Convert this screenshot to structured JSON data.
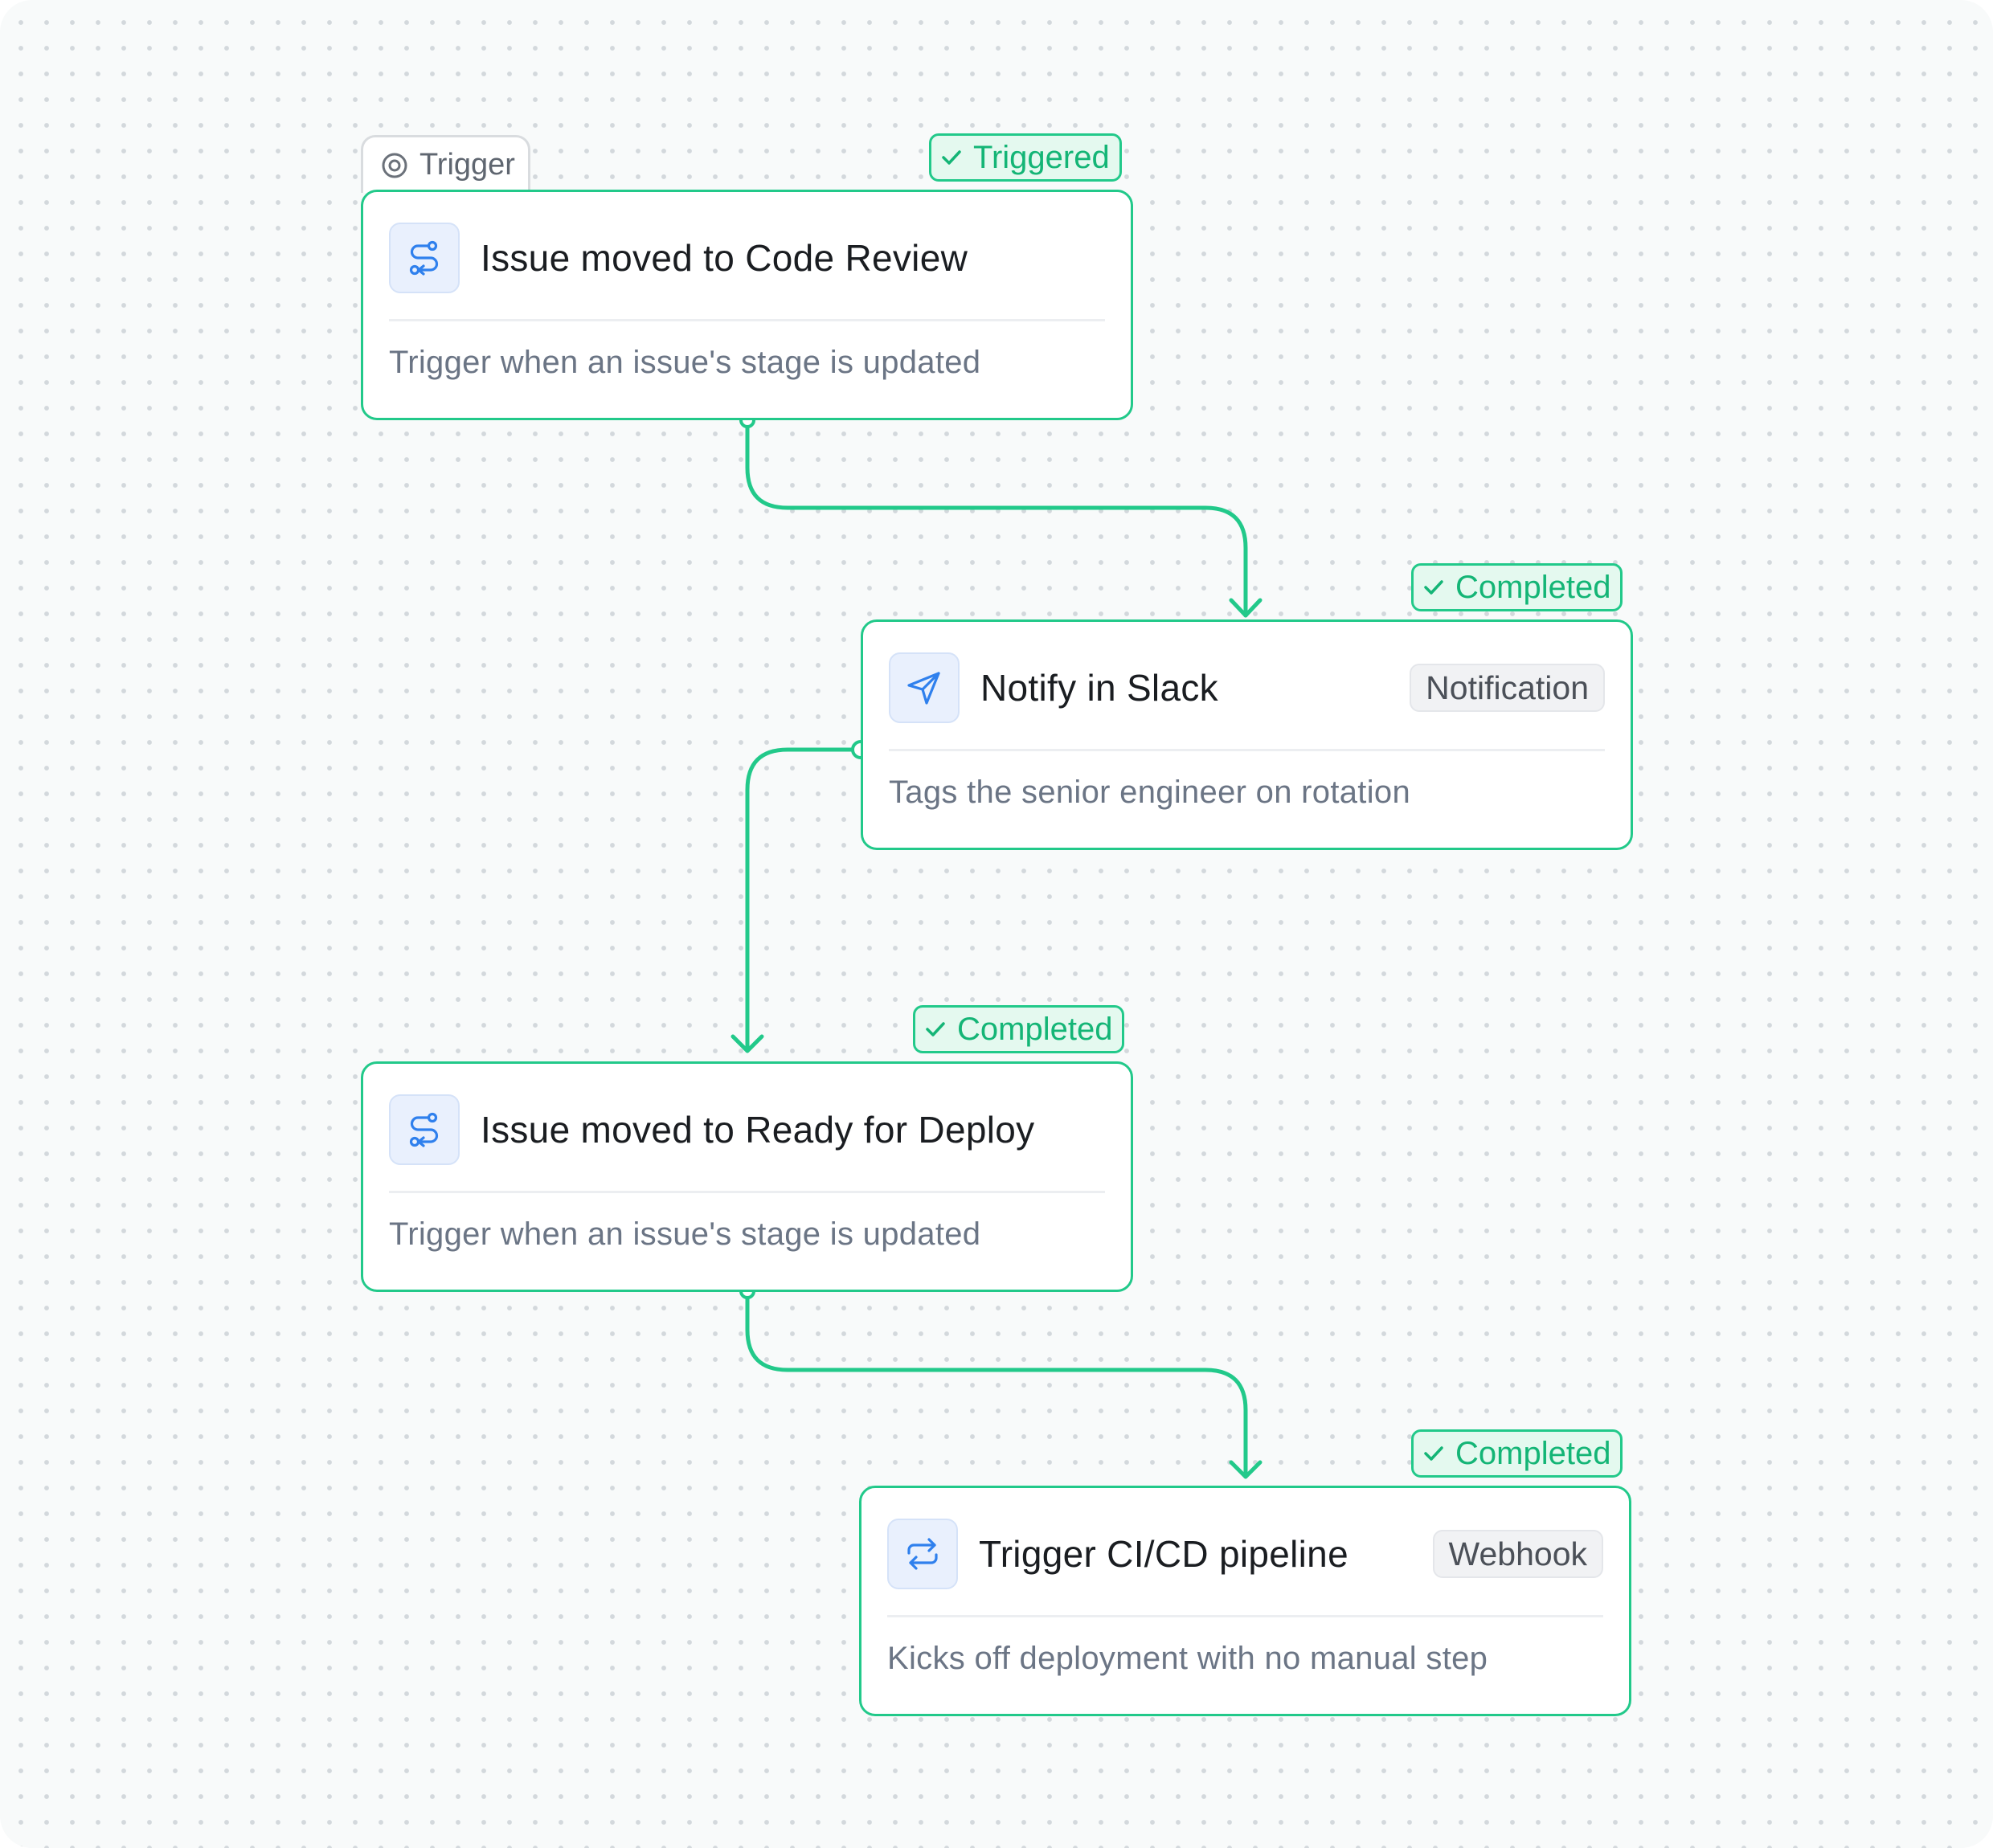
{
  "canvas": {
    "trigger_tab": {
      "label": "Trigger",
      "icon": "target-icon"
    },
    "nodes": [
      {
        "title": "Issue moved to Code Review",
        "description": "Trigger when an issue's stage is updated",
        "icon": "workflow-route-icon",
        "status": "Triggered"
      },
      {
        "title": "Notify in Slack",
        "description": "Tags the senior engineer on rotation",
        "icon": "send-icon",
        "type_label": "Notification",
        "status": "Completed"
      },
      {
        "title": "Issue moved to Ready for Deploy",
        "description": "Trigger when an issue's stage is updated",
        "icon": "workflow-route-icon",
        "status": "Completed"
      },
      {
        "title": "Trigger CI/CD pipeline",
        "description": "Kicks off deployment with no manual step",
        "icon": "repeat-arrows-icon",
        "type_label": "Webhook",
        "status": "Completed"
      }
    ],
    "colors": {
      "accent": "#22c98a",
      "accent_text": "#14b576",
      "badge_bg": "#e4f9ef",
      "icon_blue": "#2f80ed",
      "icon_bg": "#e9f0fd",
      "canvas_bg": "#f8fafa",
      "dot": "#d3d8dc"
    }
  }
}
